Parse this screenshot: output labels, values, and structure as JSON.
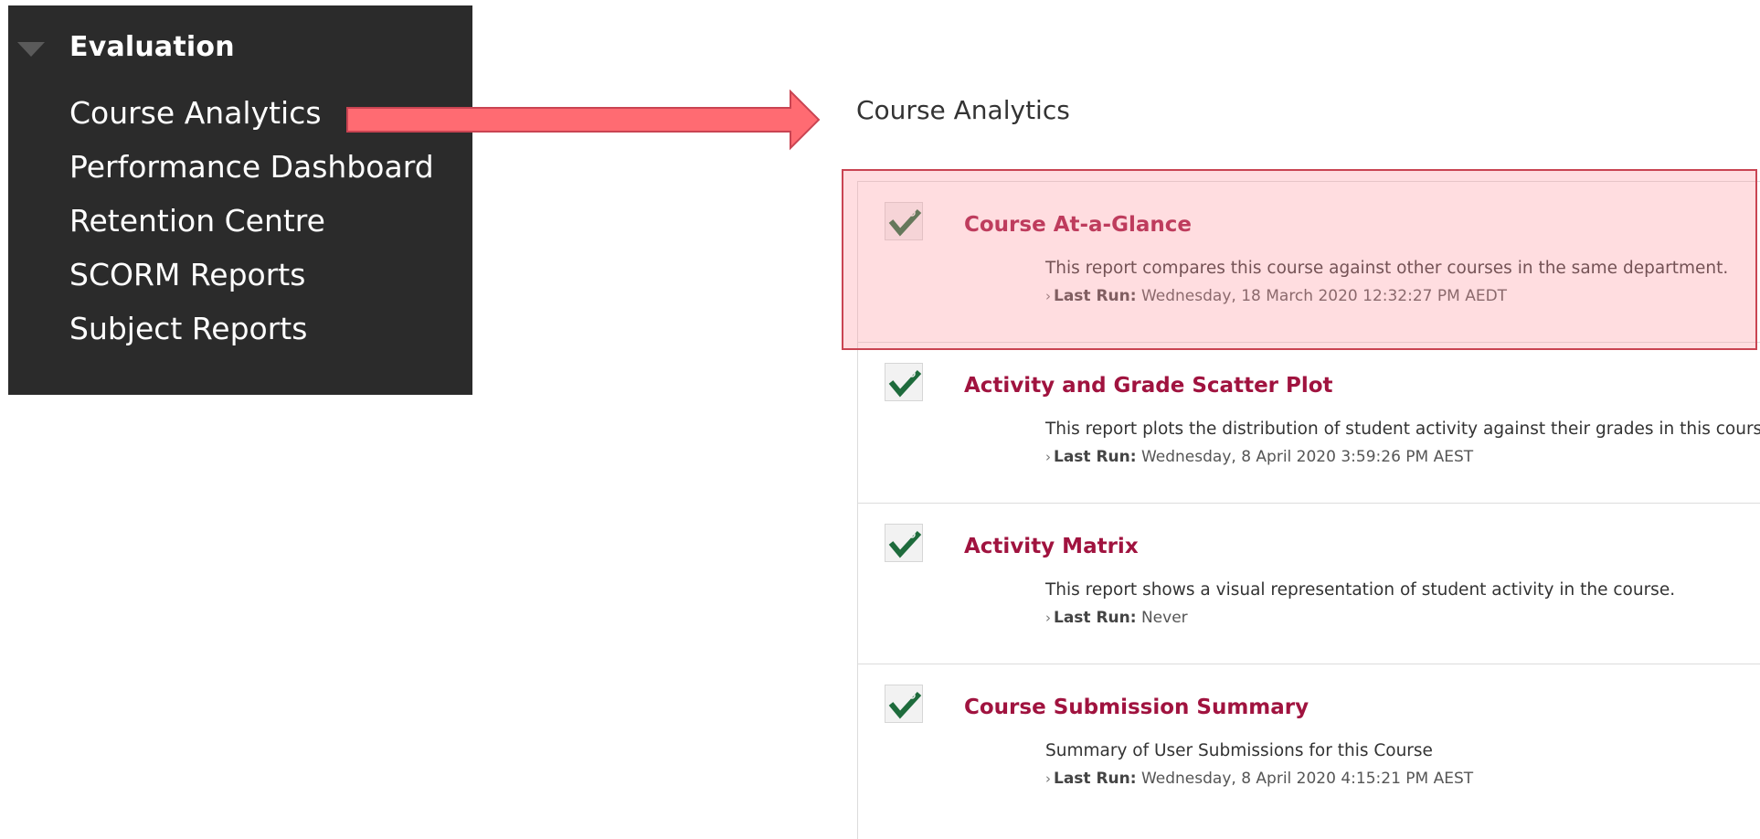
{
  "sidebar": {
    "heading": "Evaluation",
    "items": [
      {
        "label": "Course Analytics"
      },
      {
        "label": "Performance Dashboard"
      },
      {
        "label": "Retention Centre"
      },
      {
        "label": "SCORM Reports"
      },
      {
        "label": "Subject Reports"
      }
    ]
  },
  "main": {
    "title": "Course Analytics",
    "last_run_label": "Last Run:",
    "reports": [
      {
        "title": "Course At-a-Glance",
        "description": "This report compares this course against other courses in the same department.",
        "last_run": "Wednesday, 18 March 2020 12:32:27 PM AEDT"
      },
      {
        "title": "Activity and Grade Scatter Plot",
        "description": "This report plots the distribution of student activity against their grades in this course.",
        "last_run": "Wednesday, 8 April 2020 3:59:26 PM AEST"
      },
      {
        "title": "Activity Matrix",
        "description": "This report shows a visual representation of student activity in the course.",
        "last_run": "Never"
      },
      {
        "title": "Course Submission Summary",
        "description": "Summary of User Submissions for this Course",
        "last_run": "Wednesday, 8 April 2020 4:15:21 PM AEST"
      }
    ]
  },
  "icons": {
    "menu_toggle": "triangle-down-icon",
    "report_status": "check-icon",
    "last_run_bullet": "chevron-right-icon",
    "annotation": "arrow-right-icon"
  },
  "colors": {
    "sidebar_bg": "#2b2b2b",
    "report_title": "#a0133f",
    "check_green": "#1e6b3c",
    "highlight_fill": "#ffc9cf",
    "highlight_border": "#c94452",
    "arrow_fill": "#ff6b72"
  }
}
